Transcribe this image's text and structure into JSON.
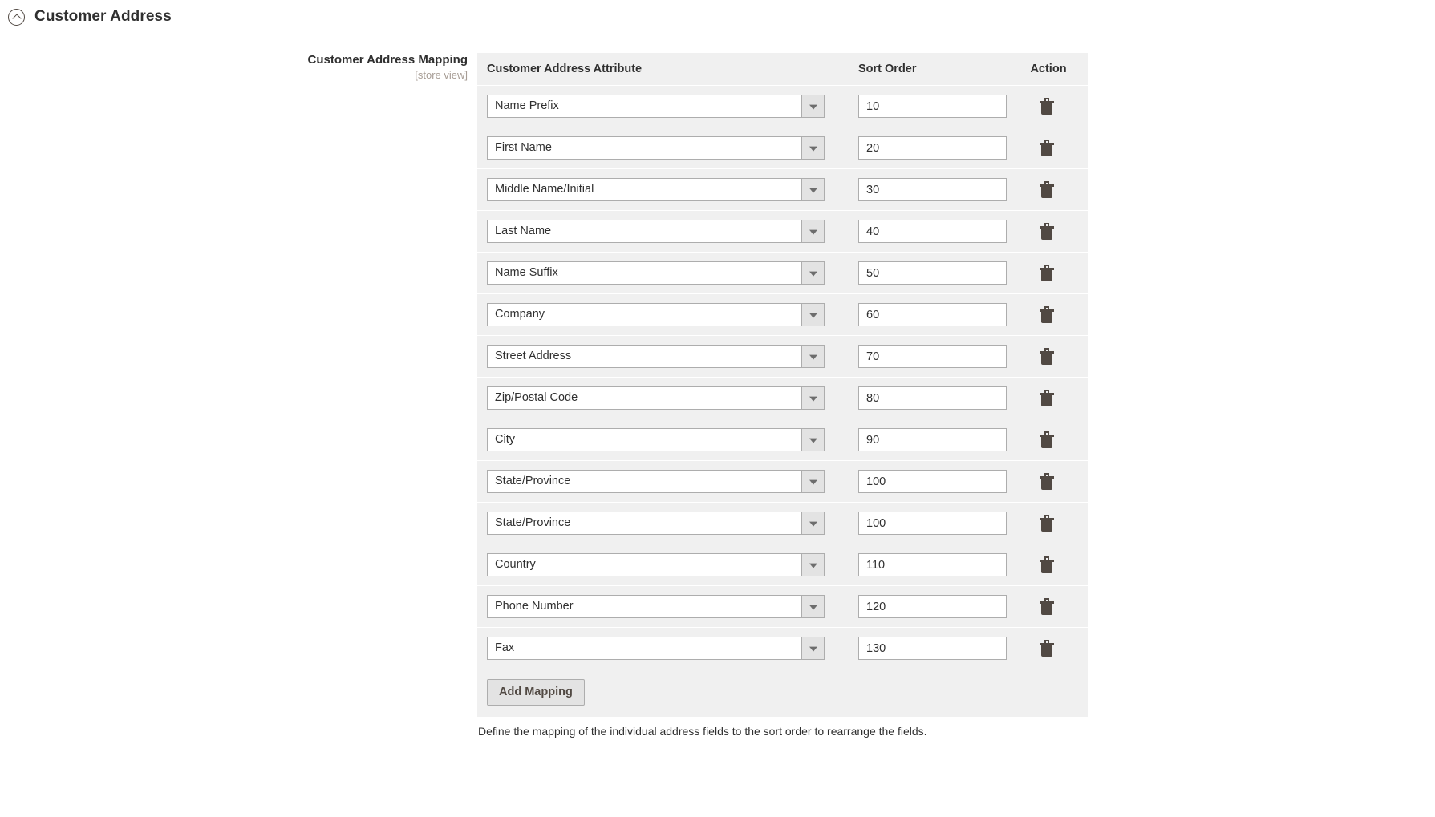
{
  "section": {
    "title": "Customer Address",
    "collapse_icon": "chevron-up-circle-icon"
  },
  "field": {
    "label": "Customer Address Mapping",
    "scope": "[store view]",
    "note": "Define the mapping of the individual address fields to the sort order to rearrange the fields.",
    "add_button_label": "Add Mapping"
  },
  "table": {
    "columns": [
      "Customer Address Attribute",
      "Sort Order",
      "Action"
    ],
    "delete_icon": "trash-icon",
    "dropdown_icon": "chevron-down-icon",
    "sort_order_placeholder": "",
    "rows": [
      {
        "attribute": "Name Prefix",
        "sort_order": "10"
      },
      {
        "attribute": "First Name",
        "sort_order": "20"
      },
      {
        "attribute": "Middle Name/Initial",
        "sort_order": "30"
      },
      {
        "attribute": "Last Name",
        "sort_order": "40"
      },
      {
        "attribute": "Name Suffix",
        "sort_order": "50"
      },
      {
        "attribute": "Company",
        "sort_order": "60"
      },
      {
        "attribute": "Street Address",
        "sort_order": "70"
      },
      {
        "attribute": "Zip/Postal Code",
        "sort_order": "80"
      },
      {
        "attribute": "City",
        "sort_order": "90"
      },
      {
        "attribute": "State/Province",
        "sort_order": "100"
      },
      {
        "attribute": "State/Province",
        "sort_order": "100"
      },
      {
        "attribute": "Country",
        "sort_order": "110"
      },
      {
        "attribute": "Phone Number",
        "sort_order": "120"
      },
      {
        "attribute": "Fax",
        "sort_order": "130"
      }
    ]
  },
  "colors": {
    "row_bg": "#f0f0f0",
    "page_bg": "#ffffff",
    "text": "#303030",
    "scope_text": "#a79d95",
    "border": "#adadad",
    "icon": "#514943"
  }
}
